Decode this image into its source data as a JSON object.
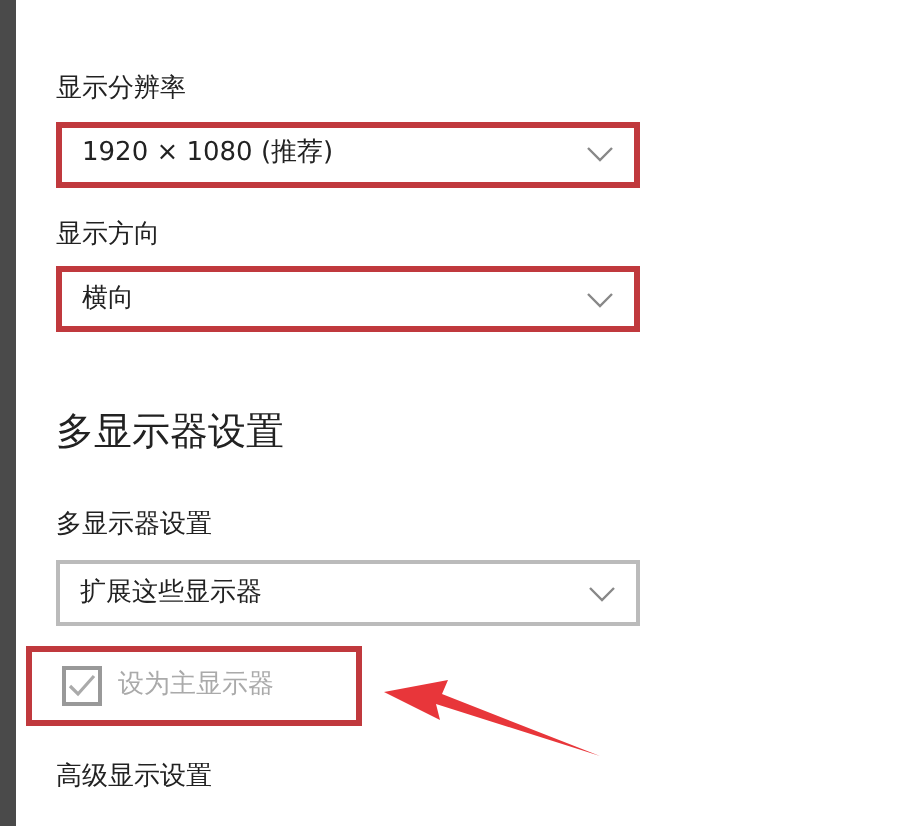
{
  "fields": [
    {
      "label": "显示分辨率",
      "value": "1920 × 1080 (推荐)",
      "highlighted": true
    },
    {
      "label": "显示方向",
      "value": "横向",
      "highlighted": true
    }
  ],
  "multi_display": {
    "heading": "多显示器设置",
    "label": "多显示器设置",
    "value": "扩展这些显示器",
    "highlighted": false
  },
  "primary_checkbox": {
    "label": "设为主显示器",
    "checked": true,
    "disabled": true,
    "highlighted": true,
    "pointed_by_arrow": true
  },
  "advanced_link": "高级显示设置"
}
